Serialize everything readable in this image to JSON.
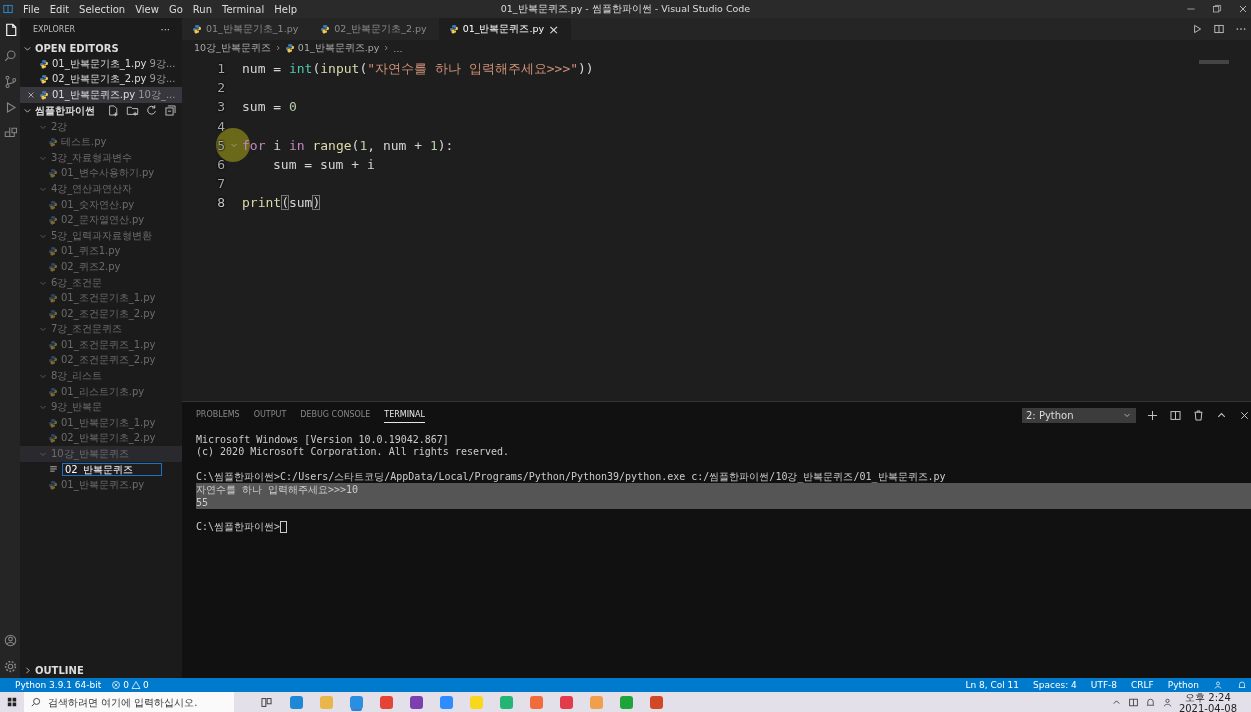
{
  "window": {
    "title": "01_반복문퀴즈.py - 씸플한파이썬 - Visual Studio Code"
  },
  "menu": [
    "File",
    "Edit",
    "Selection",
    "View",
    "Go",
    "Run",
    "Terminal",
    "Help"
  ],
  "activity_bar": [
    {
      "kind": "files",
      "selected": true
    },
    {
      "kind": "search",
      "selected": false
    },
    {
      "kind": "source-control",
      "selected": false
    },
    {
      "kind": "run",
      "selected": false
    },
    {
      "kind": "extensions",
      "selected": false
    }
  ],
  "activity_bar_bottom": [
    {
      "kind": "account"
    },
    {
      "kind": "settings"
    }
  ],
  "sidebar": {
    "title": "EXPLORER",
    "more": "···",
    "open_editors": {
      "title": "OPEN EDITORS",
      "expanded": true,
      "items": [
        {
          "name": "01_반복문기초_1.py",
          "folder": "9강...",
          "selected": false
        },
        {
          "name": "02_반복문기초_2.py",
          "folder": "9강...",
          "selected": false
        },
        {
          "name": "01_반복문퀴즈.py",
          "folder": "10강_...",
          "selected": true
        }
      ]
    },
    "folder": {
      "title": "씸플한파이썬",
      "expanded": true,
      "tree": [
        {
          "kind": "folder",
          "label": "2강",
          "expanded": true,
          "children": [
            {
              "kind": "file",
              "label": "테스트.py"
            }
          ]
        },
        {
          "kind": "folder",
          "label": "3강_자료형과변수",
          "expanded": true,
          "children": [
            {
              "kind": "file",
              "label": "01_변수사용하기.py"
            }
          ]
        },
        {
          "kind": "folder",
          "label": "4강_연산과연산자",
          "expanded": true,
          "children": [
            {
              "kind": "file",
              "label": "01_숫자연산.py"
            },
            {
              "kind": "file",
              "label": "02_문자열연산.py"
            }
          ]
        },
        {
          "kind": "folder",
          "label": "5강_입력과자료형변환",
          "expanded": true,
          "children": [
            {
              "kind": "file",
              "label": "01_퀴즈1.py"
            },
            {
              "kind": "file",
              "label": "02_퀴즈2.py"
            }
          ]
        },
        {
          "kind": "folder",
          "label": "6강_조건문",
          "expanded": true,
          "children": [
            {
              "kind": "file",
              "label": "01_조건문기초_1.py"
            },
            {
              "kind": "file",
              "label": "02_조건문기초_2.py"
            }
          ]
        },
        {
          "kind": "folder",
          "label": "7강_조건문퀴즈",
          "expanded": true,
          "children": [
            {
              "kind": "file",
              "label": "01_조건문퀴즈_1.py"
            },
            {
              "kind": "file",
              "label": "02_조건문퀴즈_2.py"
            }
          ]
        },
        {
          "kind": "folder",
          "label": "8강_리스트",
          "expanded": true,
          "children": [
            {
              "kind": "file",
              "label": "01_리스트기초.py"
            }
          ]
        },
        {
          "kind": "folder",
          "label": "9강_반복문",
          "expanded": true,
          "children": [
            {
              "kind": "file",
              "label": "01_반복문기초_1.py"
            },
            {
              "kind": "file",
              "label": "02_반복문기초_2.py"
            }
          ]
        },
        {
          "kind": "folder",
          "label": "10강_반복문퀴즈",
          "expanded": true,
          "children": [
            {
              "kind": "rename",
              "value": "02_반복문퀴즈"
            },
            {
              "kind": "file",
              "label": "01_반복문퀴즈.py"
            }
          ]
        }
      ]
    },
    "outline": {
      "title": "OUTLINE",
      "expanded": false
    }
  },
  "editor": {
    "tabs": [
      {
        "label": "01_반복문기초_1.py",
        "selected": false
      },
      {
        "label": "02_반복문기초_2.py",
        "selected": false
      },
      {
        "label": "01_반복문퀴즈.py",
        "selected": true,
        "close": "×"
      }
    ],
    "breadcrumb": [
      "10강_반복문퀴즈",
      "01_반복문퀴즈.py",
      "..."
    ],
    "lines": [
      {
        "number": "1",
        "tokens": [
          {
            "kind": "var",
            "text": "num"
          },
          {
            "kind": "op",
            "text": " = "
          },
          {
            "kind": "type",
            "text": "int"
          },
          {
            "kind": "op",
            "text": "("
          },
          {
            "kind": "func",
            "text": "input"
          },
          {
            "kind": "op",
            "text": "("
          },
          {
            "kind": "string",
            "text": "\"자연수를 하나 입력해주세요>>>\""
          },
          {
            "kind": "op",
            "text": "))"
          }
        ]
      },
      {
        "number": "2"
      },
      {
        "number": "3",
        "tokens": [
          {
            "kind": "var",
            "text": "sum"
          },
          {
            "kind": "op",
            "text": " = "
          },
          {
            "kind": "number",
            "text": "0"
          }
        ]
      },
      {
        "number": "4"
      },
      {
        "number": "5",
        "fold": true,
        "tokens": [
          {
            "kind": "keyword",
            "text": "for"
          },
          {
            "kind": "var",
            "text": " i "
          },
          {
            "kind": "keyword",
            "text": "in"
          },
          {
            "kind": "func",
            "text": " range"
          },
          {
            "kind": "op",
            "text": "("
          },
          {
            "kind": "number",
            "text": "1"
          },
          {
            "kind": "op",
            "text": ", "
          },
          {
            "kind": "var",
            "text": "num"
          },
          {
            "kind": "op",
            "text": " + "
          },
          {
            "kind": "number",
            "text": "1"
          },
          {
            "kind": "op",
            "text": "):"
          }
        ]
      },
      {
        "number": "6",
        "indent": true,
        "tokens": [
          {
            "kind": "var",
            "text": "sum"
          },
          {
            "kind": "op",
            "text": " = "
          },
          {
            "kind": "var",
            "text": "sum"
          },
          {
            "kind": "op",
            "text": " + "
          },
          {
            "kind": "var",
            "text": "i"
          }
        ]
      },
      {
        "number": "7"
      },
      {
        "number": "8",
        "current": true,
        "tokens": [
          {
            "kind": "func",
            "text": "print"
          },
          {
            "kind": "op",
            "text": "("
          },
          {
            "kind": "var",
            "text": "sum"
          },
          {
            "kind": "op",
            "text": ")"
          }
        ]
      }
    ]
  },
  "panel": {
    "tabs": [
      {
        "label": "PROBLEMS",
        "selected": false
      },
      {
        "label": "OUTPUT",
        "selected": false
      },
      {
        "label": "DEBUG CONSOLE",
        "selected": false
      },
      {
        "label": "TERMINAL",
        "selected": true
      }
    ],
    "terminal_select": "2: Python",
    "terminal": [
      {
        "text": "Microsoft Windows [Version 10.0.19042.867]",
        "highlighted": false
      },
      {
        "text": "(c) 2020 Microsoft Corporation. All rights reserved.",
        "highlighted": false
      },
      {
        "highlighted": false
      },
      {
        "text": "C:\\씸플한파이썬>C:/Users/스타트코딩/AppData/Local/Programs/Python/Python39/python.exe c:/씸플한파이썬/10강_반복문퀴즈/01_반복문퀴즈.py",
        "highlighted": false
      },
      {
        "text": "자연수를 하나 입력해주세요>>>10",
        "highlighted": true
      },
      {
        "text": "55",
        "highlighted": true
      },
      {
        "highlighted": false
      },
      {
        "text": "C:\\씸플한파이썬>",
        "highlighted": false,
        "cursor": true
      }
    ]
  },
  "status_bar": {
    "interpreter": "Python 3.9.1 64-bit",
    "errors": "0",
    "warnings": "0",
    "right": [
      "Ln 8, Col 11",
      "Spaces: 4",
      "UTF-8",
      "CRLF",
      "Python"
    ]
  },
  "taskbar": {
    "search_placeholder": "검색하려면 여기에 입력하십시오.",
    "apps": [
      {
        "color": "#1e88d6",
        "selected": false
      },
      {
        "color": "#e8b64a",
        "selected": false
      },
      {
        "color": "#2a8fe0",
        "selected": true
      },
      {
        "color": "#e54335",
        "selected": false
      },
      {
        "color": "#7b3fb0",
        "selected": false
      },
      {
        "color": "#2d8cff",
        "selected": false
      },
      {
        "color": "#f9d71c",
        "selected": false
      },
      {
        "color": "#22b573",
        "selected": false
      },
      {
        "color": "#f26b3a",
        "selected": false
      },
      {
        "color": "#e23b4a",
        "selected": false
      },
      {
        "color": "#f0a04b",
        "selected": false
      },
      {
        "color": "#1fa33b",
        "selected": false
      },
      {
        "color": "#d24726",
        "selected": false
      }
    ],
    "time": "오후 2:24",
    "date": "2021-04-08"
  }
}
